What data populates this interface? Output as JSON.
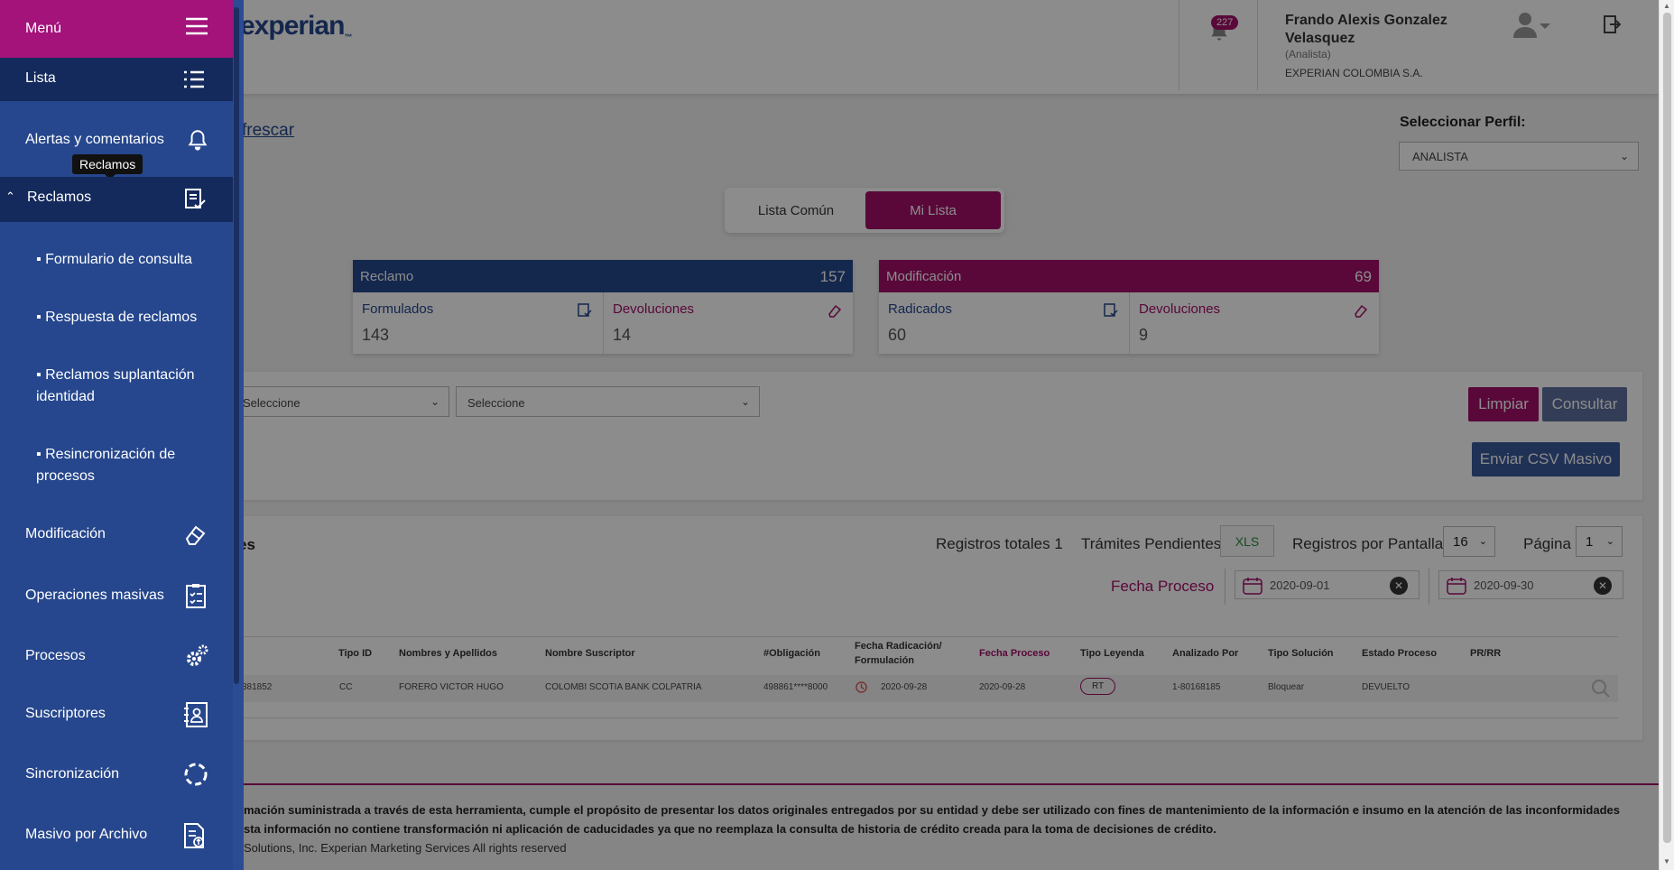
{
  "header": {
    "logo": "experian",
    "notification_count": "227",
    "user_name": "Frando Alexis Gonzalez Velasquez",
    "user_role": "(Analista)",
    "user_company": "EXPERIAN COLOMBIA S.A."
  },
  "main": {
    "refresh_label": "frescar",
    "perfil_label": "Seleccionar Perfil:",
    "perfil_value": "ANALISTA",
    "toggle": {
      "common": "Lista Común",
      "mine": "Mi Lista"
    },
    "cards": {
      "reclamo": {
        "title": "Reclamo",
        "total": "157",
        "a_label": "Formulados",
        "a_value": "143",
        "b_label": "Devoluciones",
        "b_value": "14"
      },
      "modificacion": {
        "title": "Modificación",
        "total": "69",
        "a_label": "Radicados",
        "a_value": "60",
        "b_label": "Devoluciones",
        "b_value": "9"
      }
    },
    "filters": {
      "select1": "Seleccione",
      "select2": "Seleccione",
      "limpiar": "Limpiar",
      "consultar": "Consultar",
      "enviar_csv": "Enviar CSV Masivo"
    },
    "results": {
      "title_fragment": "es",
      "registros_totales": "Registros totales 1",
      "tramites_pendientes": "Trámites Pendientes",
      "xls": "XLS",
      "registros_por_pantalla": "Registros por Pantalla",
      "per_page": "16",
      "pagina": "Página",
      "page_value": "1",
      "fecha_proceso": "Fecha Proceso",
      "date_from": "2020-09-01",
      "date_to": "2020-09-30"
    },
    "table": {
      "headers": [
        "Tipo ID",
        "Nombres y Apellidos",
        "Nombre Suscriptor",
        "#Obligación",
        "Fecha Radicación/ Formulación",
        "Fecha Proceso",
        "Tipo Leyenda",
        "Analizado Por",
        "Tipo Solución",
        "Estado Proceso",
        "PR/RR"
      ],
      "row": {
        "id_fragment": "381852",
        "tipo_id": "CC",
        "nombre": "FORERO VICTOR HUGO",
        "suscriptor": "COLOMBI SCOTIA BANK COLPATRIA",
        "obligacion": "498861****8000",
        "fecha_radicacion": "2020-09-28",
        "fecha_proceso": "2020-09-28",
        "tipo_leyenda": "RT",
        "analizado_por": "1-80168185",
        "tipo_solucion": "Bloquear",
        "estado": "DEVUELTO"
      }
    },
    "footer": {
      "line1": "mación suministrada a través de esta herramienta, cumple el propósito de presentar los datos originales entregados por su entidad y debe ser utilizado con fines de mantenimiento de la información e insumo en la atención de las inconformidades",
      "line2": "sta información no contiene transformación ni aplicación de caducidades ya que no reemplaza la consulta de historia de crédito creada para la toma de decisiones de crédito.",
      "copyright": "Solutions, Inc. Experian Marketing Services All rights reserved"
    }
  },
  "sidemenu": {
    "title": "Menú",
    "tooltip": "Reclamos",
    "items": {
      "lista": "Lista",
      "alertas": "Alertas y comentarios",
      "reclamos": "Reclamos",
      "modificacion": "Modificación",
      "operaciones": "Operaciones masivas",
      "procesos": "Procesos",
      "suscriptores": "Suscriptores",
      "sincronizacion": "Sincronización",
      "masivo": "Masivo por Archivo"
    },
    "subitems": {
      "formulario": "▪ Formulario de consulta",
      "respuesta": "▪ Respuesta de reclamos",
      "suplantacion": "▪ Reclamos suplantación identidad",
      "resincronizacion": "▪ Resincronización de procesos"
    }
  },
  "colors": {
    "brand_blue": "#26478d",
    "accent_magenta": "#a30f68",
    "menu_dark": "#142a5c"
  }
}
